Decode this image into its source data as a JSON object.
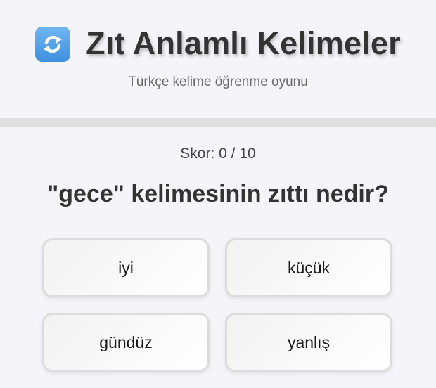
{
  "header": {
    "icon": "refresh-arrows-icon",
    "title": "Zıt Anlamlı Kelimeler",
    "subtitle": "Türkçe kelime öğrenme oyunu"
  },
  "game": {
    "score": "Skor: 0 / 10",
    "question": "\"gece\" kelimesinin zıttı nedir?",
    "options": [
      "iyi",
      "küçük",
      "gündüz",
      "yanlış"
    ]
  },
  "colors": {
    "background": "#f5f4f9",
    "divider": "#e0e0e0",
    "icon_blue": "#4a9be8",
    "text": "#333333"
  }
}
